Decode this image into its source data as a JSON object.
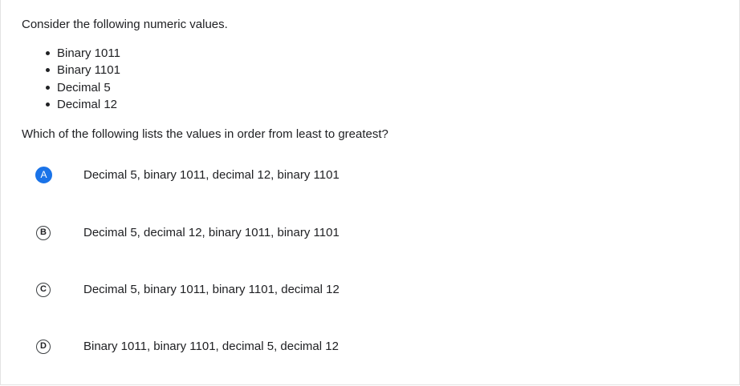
{
  "question": {
    "prompt": "Consider the following numeric values.",
    "values": [
      "Binary 1011",
      "Binary 1101",
      "Decimal 5",
      "Decimal 12"
    ],
    "ask": "Which of the following lists the values in order from least to greatest?",
    "options": [
      {
        "letter": "A",
        "text": "Decimal 5, binary 1011, decimal 12, binary 1101",
        "selected": true
      },
      {
        "letter": "B",
        "text": "Decimal 5, decimal 12, binary 1011, binary 1101",
        "selected": false
      },
      {
        "letter": "C",
        "text": "Decimal 5, binary 1011, binary 1101, decimal 12",
        "selected": false
      },
      {
        "letter": "D",
        "text": "Binary 1011, binary 1101, decimal 5, decimal 12",
        "selected": false
      }
    ]
  },
  "colors": {
    "accent": "#1a73e8",
    "text": "#202124"
  }
}
